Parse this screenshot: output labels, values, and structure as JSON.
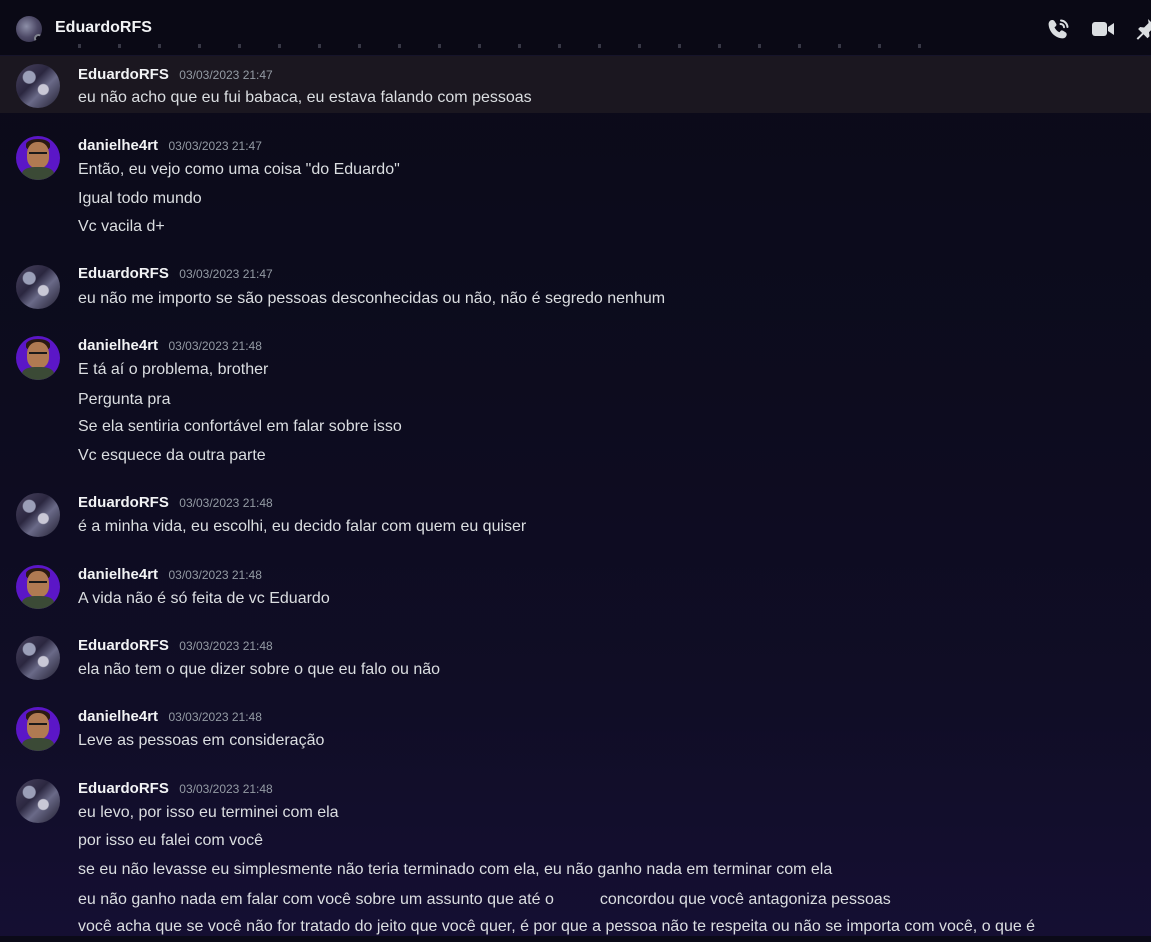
{
  "header": {
    "title": "EduardoRFS",
    "icons": [
      "phone-call-icon",
      "video-camera-icon",
      "pin-icon"
    ]
  },
  "users": {
    "eduardo": "EduardoRFS",
    "daniel": "danielhe4rt"
  },
  "messages": [
    {
      "author": "EduardoRFS",
      "timestamp": "03/03/2023 21:47",
      "lines": [
        "eu não acho que eu fui babaca, eu estava falando com pessoas"
      ]
    },
    {
      "author": "danielhe4rt",
      "timestamp": "03/03/2023 21:47",
      "lines": [
        "Então, eu vejo como uma coisa \"do Eduardo\"",
        "Igual todo mundo",
        "Vc vacila d+"
      ]
    },
    {
      "author": "EduardoRFS",
      "timestamp": "03/03/2023 21:47",
      "lines": [
        "eu não me importo se são pessoas desconhecidas ou não, não é segredo nenhum"
      ]
    },
    {
      "author": "danielhe4rt",
      "timestamp": "03/03/2023 21:48",
      "lines": [
        "E tá aí o problema, brother",
        "Pergunta pra",
        "Se ela sentiria confortável em falar sobre isso",
        "Vc esquece da outra parte"
      ]
    },
    {
      "author": "EduardoRFS",
      "timestamp": "03/03/2023 21:48",
      "lines": [
        "é a minha vida, eu escolhi, eu decido falar com quem eu quiser"
      ]
    },
    {
      "author": "danielhe4rt",
      "timestamp": "03/03/2023 21:48",
      "lines": [
        "A vida não é só feita de vc Eduardo"
      ]
    },
    {
      "author": "EduardoRFS",
      "timestamp": "03/03/2023 21:48",
      "lines": [
        "ela não tem o que dizer sobre o que eu falo ou não"
      ]
    },
    {
      "author": "danielhe4rt",
      "timestamp": "03/03/2023 21:48",
      "lines": [
        "Leve as pessoas em consideração"
      ]
    },
    {
      "author": "EduardoRFS",
      "timestamp": "03/03/2023 21:48",
      "lines": [
        "eu levo, por isso eu terminei com ela",
        "por isso eu falei com você",
        "se eu não levasse eu simplesmente não teria terminado com ela, eu não ganho nada em terminar com ela",
        "eu não ganho nada em falar com você sobre um assunto que até o",
        "concordou que você antagoniza pessoas",
        "você acha que se você não for tratado do jeito que você quer, é por que a pessoa não te respeita ou não se importa com você, o que é"
      ]
    }
  ]
}
